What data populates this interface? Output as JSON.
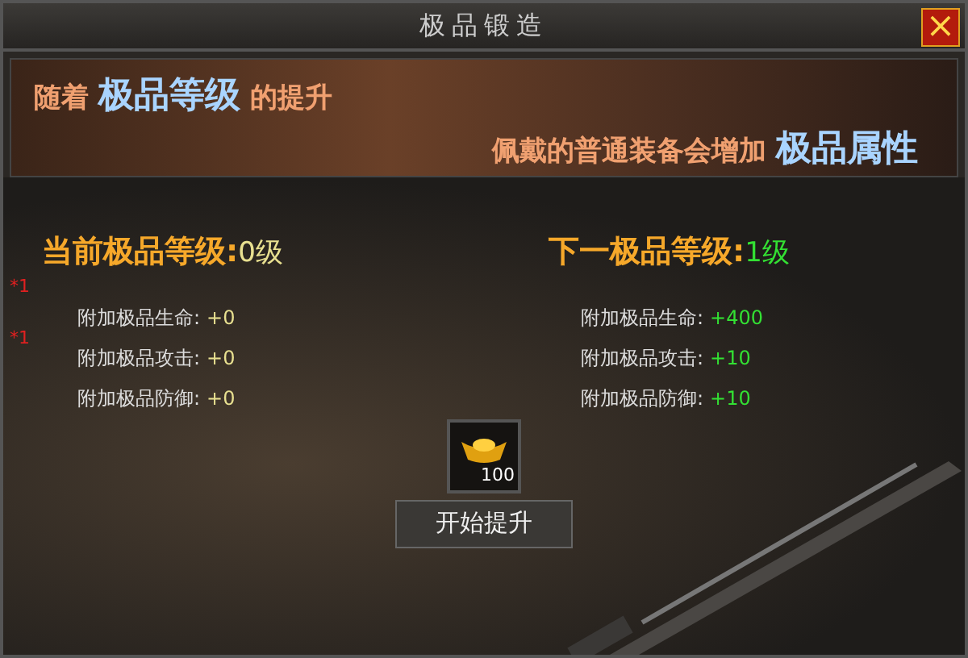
{
  "window": {
    "title": "极品锻造",
    "close": "×"
  },
  "banner": {
    "lines": [
      [
        {
          "text": "随着",
          "highlight": false
        },
        {
          "text": "极品等级",
          "highlight": true
        },
        {
          "text": "的提升",
          "highlight": false
        }
      ],
      [
        {
          "text": "佩戴的普通装备会增加",
          "highlight": false
        },
        {
          "text": "极品属性",
          "highlight": true
        }
      ]
    ]
  },
  "markers": [
    "*1",
    "*1"
  ],
  "columns": [
    {
      "kind": "current",
      "heading": "当前极品等级:",
      "level_text": "0级",
      "stats": [
        {
          "label": "附加极品生命:",
          "value": "+0"
        },
        {
          "label": "附加极品攻击:",
          "value": "+0"
        },
        {
          "label": "附加极品防御:",
          "value": "+0"
        }
      ]
    },
    {
      "kind": "next",
      "heading": "下一极品等级:",
      "level_text": "1级",
      "stats": [
        {
          "label": "附加极品生命:",
          "value": "+400"
        },
        {
          "label": "附加极品攻击:",
          "value": "+10"
        },
        {
          "label": "附加极品防御:",
          "value": "+10"
        }
      ]
    }
  ],
  "cost": {
    "count": "100"
  },
  "buttons": [
    "开始提升"
  ]
}
